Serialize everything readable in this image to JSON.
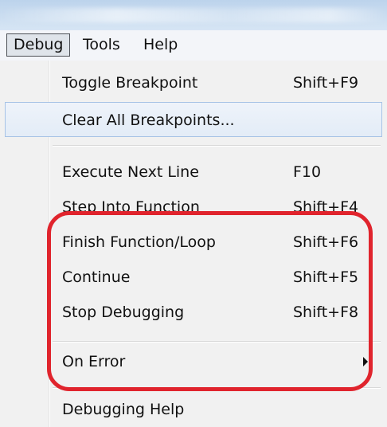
{
  "menubar": {
    "items": [
      {
        "label": "Debug",
        "active": true
      },
      {
        "label": "Tools",
        "active": false
      },
      {
        "label": "Help",
        "active": false
      }
    ]
  },
  "dropdown": {
    "items": [
      {
        "label": "Toggle Breakpoint",
        "shortcut": "Shift+F9"
      },
      {
        "label": "Clear All Breakpoints...",
        "shortcut": "",
        "hovered": true
      },
      {
        "label": "Execute Next Line",
        "shortcut": "F10"
      },
      {
        "label": "Step Into Function",
        "shortcut": "Shift+F4"
      },
      {
        "label": "Finish Function/Loop",
        "shortcut": "Shift+F6"
      },
      {
        "label": "Continue",
        "shortcut": "Shift+F5"
      },
      {
        "label": "Stop Debugging",
        "shortcut": "Shift+F8"
      },
      {
        "label": "On Error",
        "shortcut": "",
        "has_submenu": true
      },
      {
        "label": "Debugging Help",
        "shortcut": ""
      }
    ]
  },
  "annotation": {
    "color": "#e0242d",
    "shape": "rounded-rectangle"
  },
  "icons": {
    "submenu": "chevron-right-icon"
  }
}
